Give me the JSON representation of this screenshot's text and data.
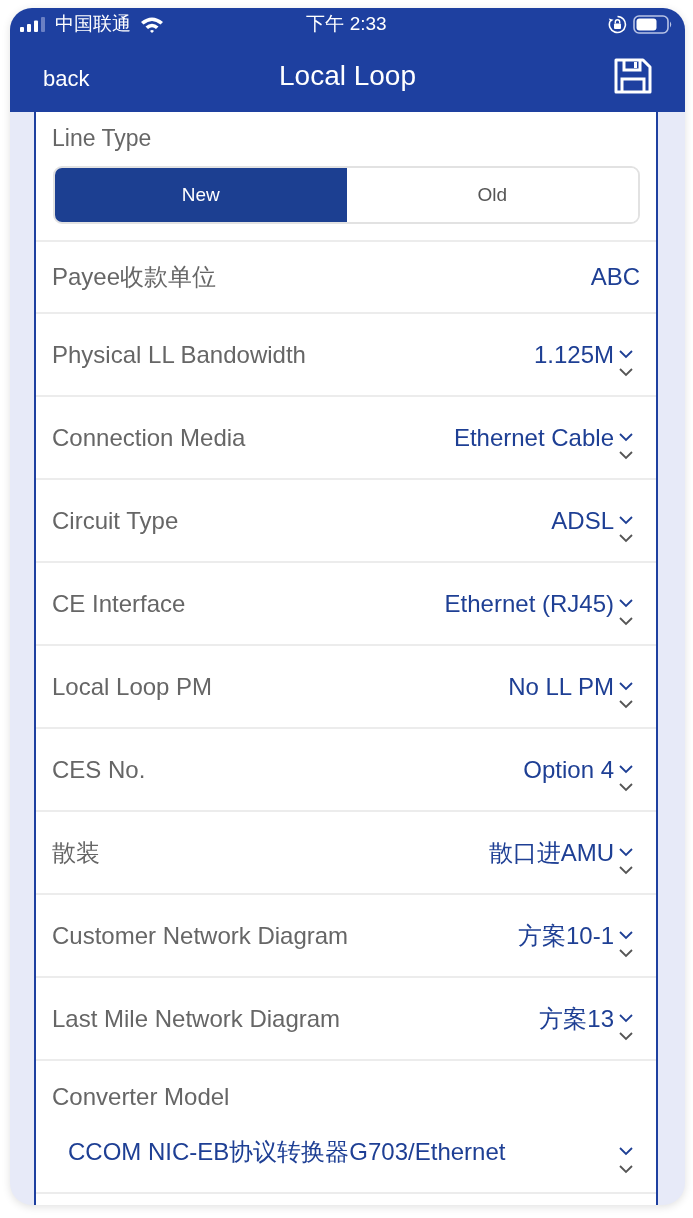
{
  "status_bar": {
    "carrier": "中国联通",
    "time": "下午 2:33"
  },
  "nav": {
    "back": "back",
    "title": "Local Loop"
  },
  "line_type": {
    "label": "Line Type",
    "options": [
      {
        "label": "New",
        "selected": true
      },
      {
        "label": "Old",
        "selected": false
      }
    ]
  },
  "fields": [
    {
      "kind": "text",
      "label": "Payee收款单位",
      "value": "ABC"
    },
    {
      "kind": "select",
      "label": "Physical LL Bandowidth",
      "value": "1.125M"
    },
    {
      "kind": "select",
      "label": "Connection Media",
      "value": "Ethernet Cable"
    },
    {
      "kind": "select",
      "label": "Circuit Type",
      "value": "ADSL"
    },
    {
      "kind": "select",
      "label": "CE Interface",
      "value": "Ethernet (RJ45)"
    },
    {
      "kind": "select",
      "label": "Local Loop PM",
      "value": "No LL PM"
    },
    {
      "kind": "select",
      "label": "CES No.",
      "value": "Option 4"
    },
    {
      "kind": "select",
      "label": "散装",
      "value": "散口进AMU"
    },
    {
      "kind": "select",
      "label": "Customer Network Diagram",
      "value": "方案10-1"
    },
    {
      "kind": "select",
      "label": "Last Mile Network Diagram",
      "value": "方案13"
    },
    {
      "kind": "select_block",
      "label": "Converter Model",
      "value": "CCOM NIC-EB协议转换器G703/Ethernet"
    }
  ]
}
